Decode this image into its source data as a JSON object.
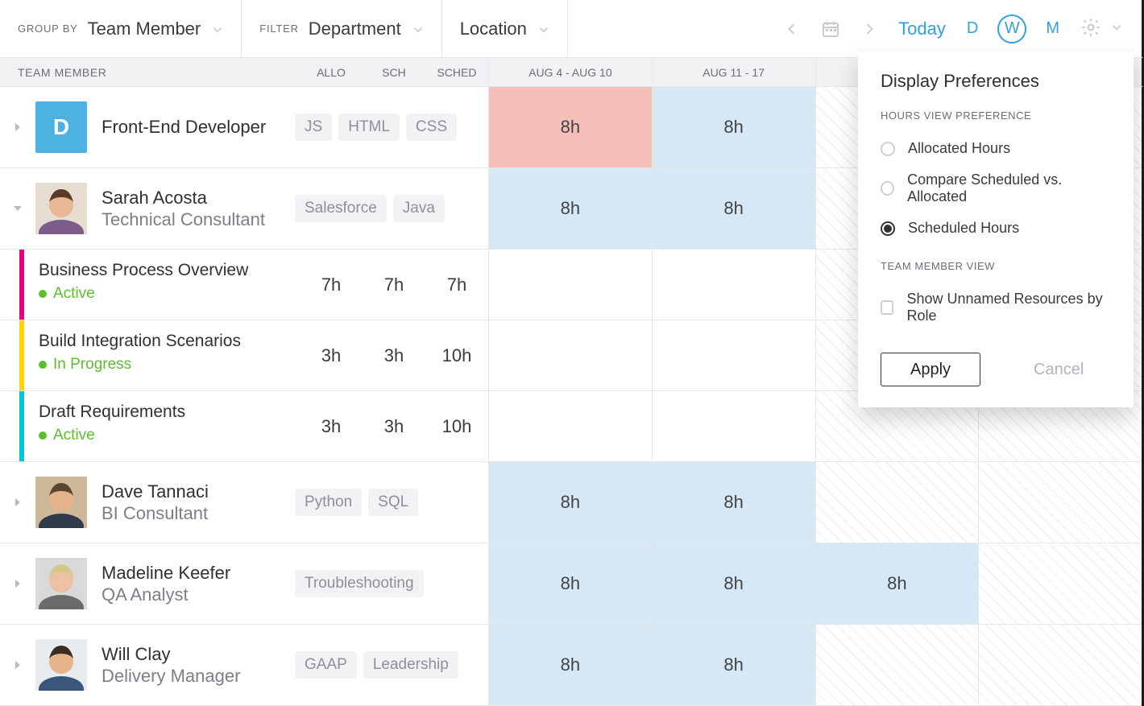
{
  "toolbar": {
    "groupBy": {
      "label": "GROUP BY",
      "value": "Team Member"
    },
    "filter": {
      "label": "FILTER",
      "value": "Department"
    },
    "location": {
      "value": "Location"
    },
    "todayLabel": "Today",
    "view": {
      "d": "D",
      "w": "W",
      "m": "M",
      "active": "W"
    }
  },
  "columns": {
    "team": "TEAM MEMBER",
    "allo": "ALLO",
    "sch": "SCH",
    "sched": "SCHED",
    "weeks": [
      "AUG 4 - AUG 10",
      "AUG 11 - 17",
      "",
      ""
    ]
  },
  "colors": {
    "statusActive": "#5bbf2b",
    "statusInProgress": "#5bbf2b",
    "stripePink": "#e6007e",
    "stripeYellow": "#ffd400",
    "stripeCyan": "#00c4d7"
  },
  "rows": [
    {
      "kind": "member",
      "avatar": {
        "type": "role",
        "letter": "D"
      },
      "name": "Front-End Developer",
      "role": "",
      "tags": [
        "JS",
        "HTML",
        "CSS"
      ],
      "cells": [
        {
          "text": "8h",
          "style": "red"
        },
        {
          "text": "8h",
          "style": "blue"
        },
        {
          "text": "",
          "style": "hatch"
        },
        {
          "text": "",
          "style": "hatch"
        }
      ],
      "expander": "right"
    },
    {
      "kind": "member",
      "avatar": {
        "type": "portrait",
        "preset": "f1"
      },
      "name": "Sarah Acosta",
      "role": "Technical Consultant",
      "tags": [
        "Salesforce",
        "Java"
      ],
      "cells": [
        {
          "text": "8h",
          "style": "blue"
        },
        {
          "text": "8h",
          "style": "blue"
        },
        {
          "text": "",
          "style": "hatch"
        },
        {
          "text": "",
          "style": "hatch"
        }
      ],
      "expander": "down"
    },
    {
      "kind": "task",
      "stripeColor": "stripePink",
      "title": "Business Process Overview",
      "status": {
        "label": "Active",
        "colorKey": "statusActive"
      },
      "allo": "7h",
      "sch": "7h",
      "sched": "7h",
      "cells": [
        {
          "style": "plain"
        },
        {
          "style": "plain"
        },
        {
          "style": "hatch"
        },
        {
          "style": "hatch"
        }
      ]
    },
    {
      "kind": "task",
      "stripeColor": "stripeYellow",
      "title": "Build Integration Scenarios",
      "status": {
        "label": "In Progress",
        "colorKey": "statusInProgress"
      },
      "allo": "3h",
      "sch": "3h",
      "sched": "10h",
      "cells": [
        {
          "style": "plain"
        },
        {
          "style": "plain"
        },
        {
          "style": "hatch"
        },
        {
          "style": "hatch"
        }
      ]
    },
    {
      "kind": "task",
      "stripeColor": "stripeCyan",
      "title": "Draft Requirements",
      "status": {
        "label": "Active",
        "colorKey": "statusActive"
      },
      "allo": "3h",
      "sch": "3h",
      "sched": "10h",
      "cells": [
        {
          "style": "plain"
        },
        {
          "style": "plain"
        },
        {
          "style": "hatch"
        },
        {
          "style": "hatch"
        }
      ]
    },
    {
      "kind": "member",
      "avatar": {
        "type": "portrait",
        "preset": "m1"
      },
      "name": "Dave Tannaci",
      "role": "BI Consultant",
      "tags": [
        "Python",
        "SQL"
      ],
      "cells": [
        {
          "text": "8h",
          "style": "blue"
        },
        {
          "text": "8h",
          "style": "blue"
        },
        {
          "text": "",
          "style": "hatch"
        },
        {
          "text": "",
          "style": "hatch"
        }
      ],
      "expander": "right"
    },
    {
      "kind": "member",
      "avatar": {
        "type": "portrait",
        "preset": "f2"
      },
      "name": "Madeline Keefer",
      "role": "QA Analyst",
      "tags": [
        "Troubleshooting"
      ],
      "cells": [
        {
          "text": "8h",
          "style": "blue"
        },
        {
          "text": "8h",
          "style": "blue"
        },
        {
          "text": "8h",
          "style": "blue"
        },
        {
          "text": "",
          "style": "hatch"
        }
      ],
      "expander": "right"
    },
    {
      "kind": "member",
      "avatar": {
        "type": "portrait",
        "preset": "m2"
      },
      "name": "Will Clay",
      "role": "Delivery Manager",
      "tags": [
        "GAAP",
        "Leadership"
      ],
      "cells": [
        {
          "text": "8h",
          "style": "blue"
        },
        {
          "text": "8h",
          "style": "blue"
        },
        {
          "text": "",
          "style": "hatch"
        },
        {
          "text": "",
          "style": "hatch"
        }
      ],
      "expander": "right"
    }
  ],
  "popover": {
    "title": "Display Preferences",
    "hoursLabel": "HOURS VIEW PREFERENCE",
    "options": [
      "Allocated Hours",
      "Compare Scheduled vs. Allocated",
      "Scheduled Hours"
    ],
    "selectedIndex": 2,
    "teamLabel": "TEAM MEMBER VIEW",
    "checkLabel": "Show Unnamed Resources by Role",
    "apply": "Apply",
    "cancel": "Cancel"
  }
}
